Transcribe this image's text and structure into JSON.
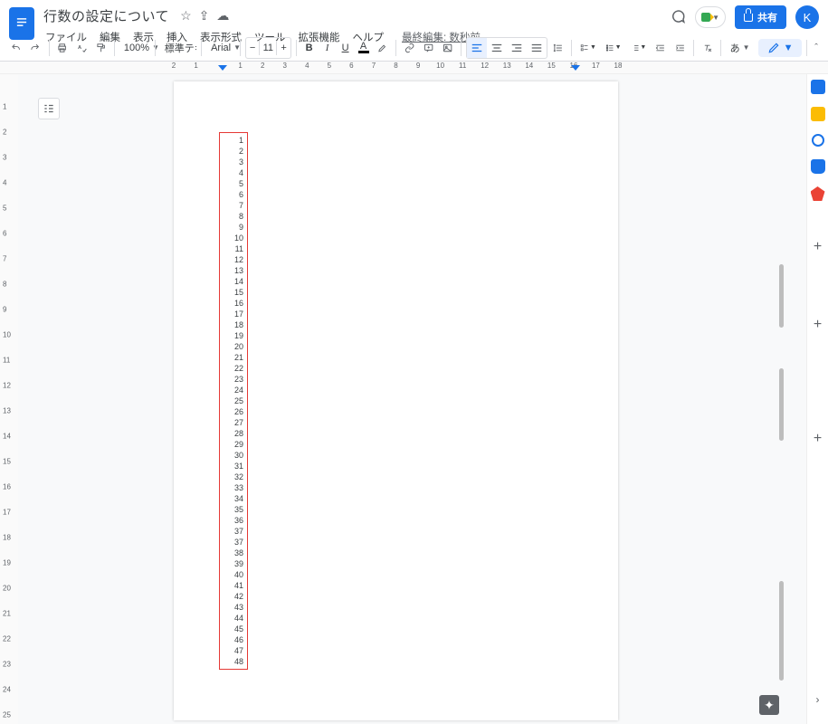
{
  "header": {
    "title": "行数の設定について",
    "star_icon": "☆",
    "move_icon": "⇪",
    "cloud_icon": "☁",
    "avatar_initial": "K"
  },
  "menu": {
    "file": "ファイル",
    "edit": "編集",
    "view": "表示",
    "insert": "挿入",
    "format": "表示形式",
    "tools": "ツール",
    "extensions": "拡張機能",
    "help": "ヘルプ",
    "status": "最終編集: 数秒前"
  },
  "share": {
    "label": "共有"
  },
  "toolbar": {
    "zoom": "100%",
    "style": "標準テキス…",
    "font": "Arial",
    "minus": "−",
    "plus": "+",
    "fontsize": "11",
    "bold": "B",
    "italic": "I",
    "underline": "U",
    "textA": "A",
    "input_ja": "あ"
  },
  "ruler": {
    "ticks": [
      "2",
      "1",
      "",
      "1",
      "2",
      "3",
      "4",
      "5",
      "6",
      "7",
      "8",
      "9",
      "10",
      "11",
      "12",
      "13",
      "14",
      "15",
      "16",
      "17",
      "18"
    ]
  },
  "vruler": [
    "",
    "1",
    "2",
    "3",
    "4",
    "5",
    "6",
    "7",
    "8",
    "9",
    "10",
    "11",
    "12",
    "13",
    "14",
    "15",
    "16",
    "17",
    "18",
    "19",
    "20",
    "21",
    "22",
    "23",
    "24",
    "25"
  ],
  "lines": [
    "1",
    "2",
    "3",
    "4",
    "5",
    "6",
    "7",
    "8",
    "9",
    "10",
    "11",
    "12",
    "13",
    "14",
    "15",
    "16",
    "17",
    "18",
    "19",
    "20",
    "21",
    "22",
    "23",
    "24",
    "25",
    "26",
    "27",
    "28",
    "29",
    "30",
    "31",
    "32",
    "33",
    "34",
    "35",
    "36",
    "37",
    "37",
    "38",
    "39",
    "40",
    "41",
    "42",
    "43",
    "44",
    "45",
    "46",
    "47",
    "48"
  ]
}
